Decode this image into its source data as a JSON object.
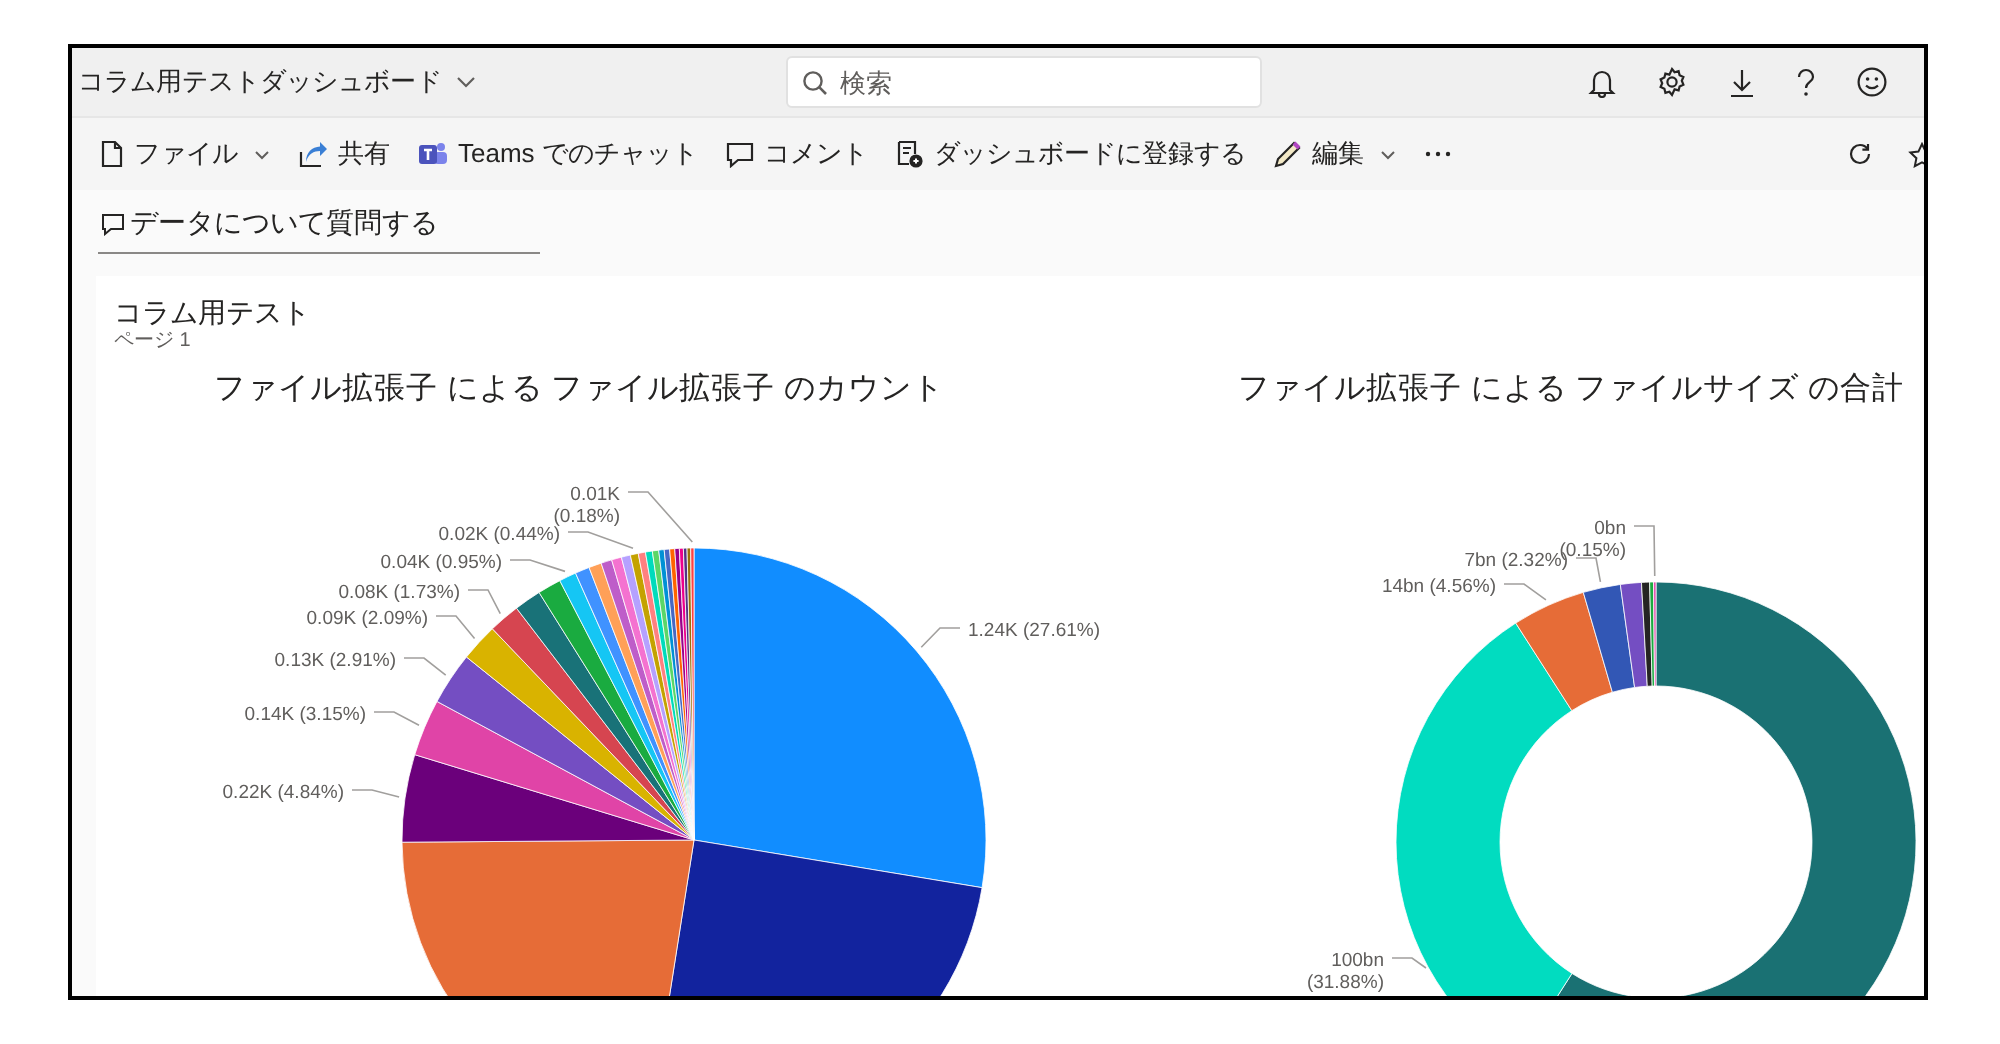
{
  "top_bar": {
    "dashboard_name": "コラム用テストダッシュボード",
    "search": {
      "placeholder": "検索"
    }
  },
  "toolbar": {
    "items": [
      {
        "kind": "file",
        "label": "ファイル",
        "dropdown": true
      },
      {
        "kind": "share",
        "label": "共有",
        "dropdown": false
      },
      {
        "kind": "teams",
        "label": "Teams でのチャット",
        "dropdown": false
      },
      {
        "kind": "comment",
        "label": "コメント",
        "dropdown": false
      },
      {
        "kind": "pin",
        "label": "ダッシュボードに登録する",
        "dropdown": false
      },
      {
        "kind": "edit",
        "label": "編集",
        "dropdown": true
      },
      {
        "kind": "more",
        "dropdown": false
      }
    ]
  },
  "qna": {
    "placeholder": "データについて質問する"
  },
  "report": {
    "title": "コラム用テスト",
    "page": "ページ 1",
    "visuals": [
      {
        "chart_data": {
          "type": "pie",
          "title": "ファイル拡張子 による ファイル拡張子 のカウント",
          "values": [
            27.61,
            24.87,
            22.4,
            4.84,
            3.15,
            2.91,
            2.09,
            1.73,
            1.5,
            1.3,
            0.95,
            0.8,
            0.7,
            0.6,
            0.55,
            0.5,
            0.44,
            0.4,
            0.38,
            0.35,
            0.3,
            0.3,
            0.28,
            0.25,
            0.22,
            0.2,
            0.2,
            0.18
          ],
          "value_labels": [
            "1.24K (27.61%)",
            null,
            null,
            "0.22K (4.84%)",
            "0.14K (3.15%)",
            "0.13K (2.91%)",
            "0.09K (2.09%)",
            "0.08K (1.73%)",
            null,
            null,
            "0.04K (0.95%)",
            null,
            null,
            null,
            null,
            null,
            "0.02K (0.44%)",
            null,
            null,
            null,
            null,
            null,
            null,
            null,
            null,
            null,
            null,
            "0.01K (0.18%)"
          ]
        }
      },
      {
        "chart_data": {
          "type": "donut",
          "title": "ファイル拡張子 による ファイルサイズ の合計",
          "values": [
            59.05,
            31.88,
            4.56,
            2.32,
            1.3,
            0.5,
            0.24,
            0.15
          ],
          "value_labels": [
            null,
            "100bn (31.88%)",
            "14bn (4.56%)",
            "7bn (2.32%)",
            null,
            null,
            null,
            "0bn (0.15%)"
          ]
        }
      }
    ]
  }
}
